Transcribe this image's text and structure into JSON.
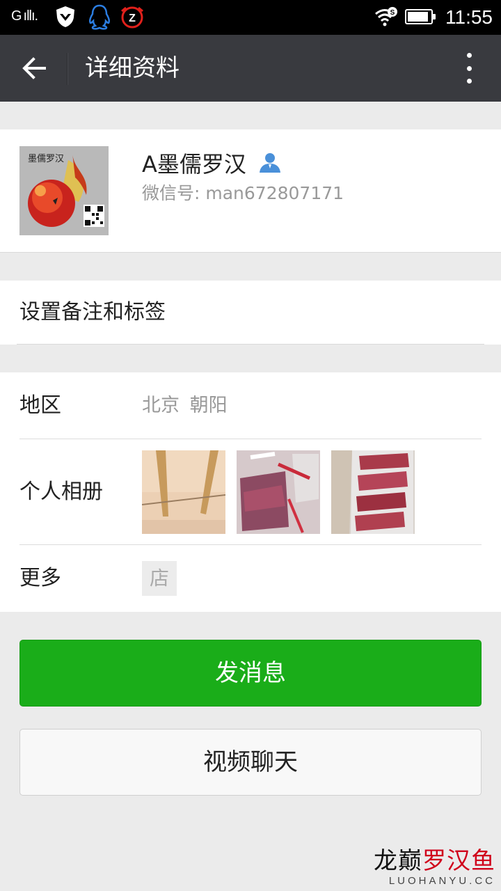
{
  "status_bar": {
    "signal_text": "G ıllı.",
    "time": "11:55",
    "wifi_badge": "S",
    "battery_level": 0.9,
    "icons": [
      "signal-icon",
      "shield-icon",
      "qq-penguin-icon",
      "z-app-icon",
      "wifi-icon",
      "battery-icon"
    ]
  },
  "header": {
    "title": "详细资料",
    "back_icon": "arrow-left-icon",
    "more_icon": "vertical-dots-icon"
  },
  "profile": {
    "avatar_text": "墨儒罗汉",
    "nickname": "A墨儒罗汉",
    "wechat_id": "微信号: man672807171",
    "contact_icon": "person-icon",
    "contact_icon_color": "#4a90d9"
  },
  "remark": {
    "label": "设置备注和标签"
  },
  "details": {
    "region_label": "地区",
    "region_value": "北京 朝阳",
    "album_label": "个人相册",
    "album_count": 3,
    "more_label": "更多",
    "shop_icon_text": "店"
  },
  "actions": {
    "send_message": "发消息",
    "video_call": "视频聊天",
    "send_color": "#1aad19"
  },
  "watermark": {
    "part1": "龙巅",
    "part2": "罗汉鱼",
    "sub": "LUOHANYU.CC"
  }
}
